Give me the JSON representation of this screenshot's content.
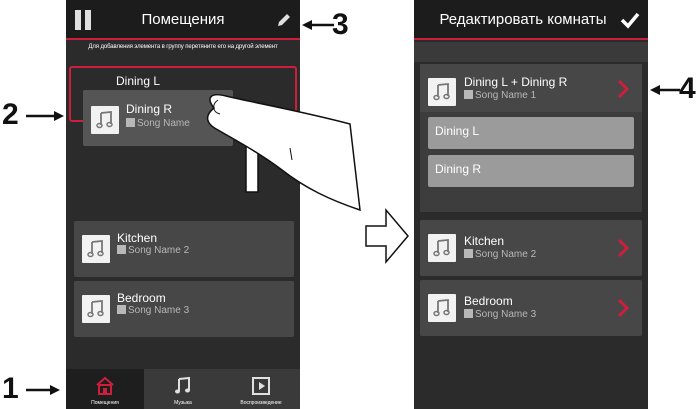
{
  "left_screen": {
    "title": "Помещения",
    "hint": "Для добавления элемента в группу перетяните его на другой элемент",
    "group_target_name": "Dining L",
    "dragged_room": {
      "name": "Dining R",
      "song": "Song Name"
    },
    "rooms": [
      {
        "name": "Kitchen",
        "song": "Song Name 2"
      },
      {
        "name": "Bedroom",
        "song": "Song Name 3"
      }
    ],
    "tabs": [
      {
        "label": "Помещения",
        "icon": "house-icon",
        "active": true
      },
      {
        "label": "Музыка",
        "icon": "music-note-icon",
        "active": false
      },
      {
        "label": "Воспроизведение",
        "icon": "play-icon",
        "active": false
      }
    ]
  },
  "right_screen": {
    "title": "Редактировать комнаты",
    "group": {
      "name": "Dining L + Dining R",
      "song": "Song Name 1",
      "members": [
        "Dining L",
        "Dining R"
      ]
    },
    "rooms": [
      {
        "name": "Kitchen",
        "song": "Song Name 2"
      },
      {
        "name": "Bedroom",
        "song": "Song Name 3"
      }
    ]
  },
  "callouts": [
    "1",
    "2",
    "3",
    "4"
  ],
  "colors": {
    "accent": "#cc1f3c",
    "background": "#2b2b2b",
    "titlebar": "#1c1c1c",
    "row": "#474747"
  }
}
